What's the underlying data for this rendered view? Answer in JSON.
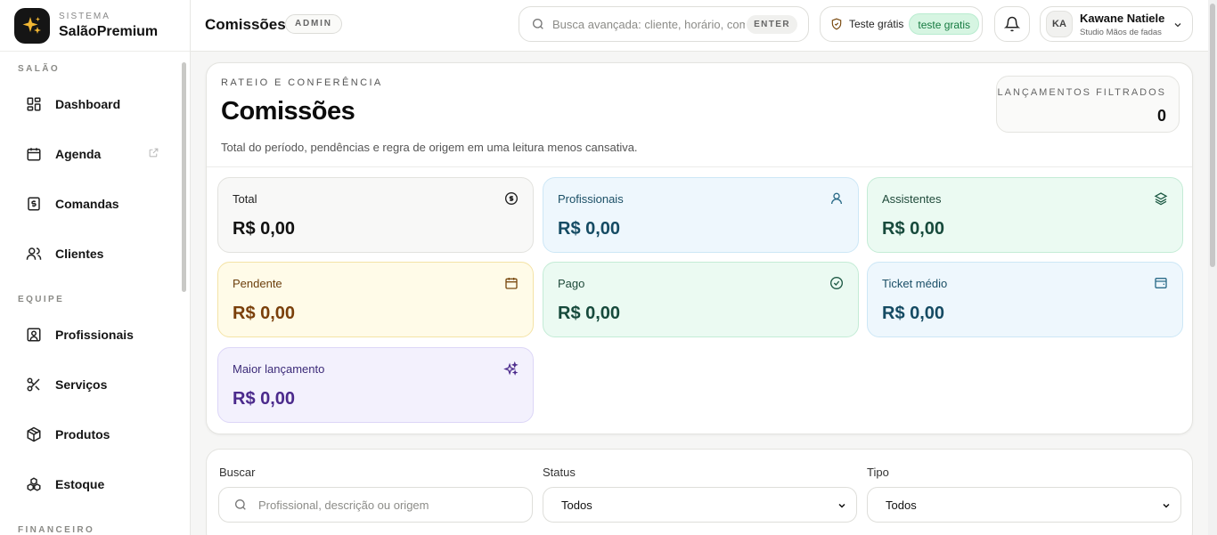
{
  "brand": {
    "system_label": "SISTEMA",
    "name": "SalãoPremium",
    "logo_icon": "sparkles-icon"
  },
  "sidebar": {
    "sections": [
      {
        "title": "SALÃO",
        "items": [
          {
            "label": "Dashboard",
            "icon": "grid-icon"
          },
          {
            "label": "Agenda",
            "icon": "calendar-icon",
            "external": true
          },
          {
            "label": "Comandas",
            "icon": "receipt-icon"
          },
          {
            "label": "Clientes",
            "icon": "users-icon"
          }
        ]
      },
      {
        "title": "EQUIPE",
        "items": [
          {
            "label": "Profissionais",
            "icon": "id-badge-icon"
          },
          {
            "label": "Serviços",
            "icon": "scissors-icon"
          },
          {
            "label": "Produtos",
            "icon": "box-icon"
          },
          {
            "label": "Estoque",
            "icon": "boxes-icon"
          }
        ]
      },
      {
        "title": "FINANCEIRO"
      }
    ]
  },
  "header": {
    "title": "Comissões",
    "role": "ADMIN",
    "search_placeholder": "Busca avançada: cliente, horário, comanda",
    "search_key": "ENTER",
    "trial_label": "Teste grátis",
    "trial_status": "teste gratis",
    "user": {
      "initials": "KA",
      "name": "Kawane Natiele",
      "studio": "Studio Mãos de fadas"
    }
  },
  "summary": {
    "eyebrow": "RATEIO E CONFERÊNCIA",
    "title": "Comissões",
    "description": "Total do período, pendências e regra de origem em uma leitura menos cansativa.",
    "counter_label": "LANÇAMENTOS FILTRADOS",
    "counter_value": "0",
    "stats": [
      {
        "label": "Total",
        "value": "R$ 0,00",
        "icon": "dollar-circle-icon",
        "bg": "#f8f8f7",
        "border": "#e2e2de",
        "label_color": "#222222",
        "value_color": "#111111",
        "icon_color": "#222222"
      },
      {
        "label": "Profissionais",
        "value": "R$ 0,00",
        "icon": "user-icon",
        "bg": "#eef7fd",
        "border": "#cde7f6",
        "label_color": "#1b4f66",
        "value_color": "#154b63",
        "icon_color": "#2a6b88"
      },
      {
        "label": "Assistentes",
        "value": "R$ 0,00",
        "icon": "layers-icon",
        "bg": "#ebfaf2",
        "border": "#c4ecd6",
        "label_color": "#1f4a3a",
        "value_color": "#174a3c",
        "icon_color": "#1e5a45"
      },
      {
        "label": "Pendente",
        "value": "R$ 0,00",
        "icon": "calendar-icon",
        "bg": "#fffbe8",
        "border": "#f4e3a6",
        "label_color": "#6b3e0c",
        "value_color": "#7a3f0a",
        "icon_color": "#7a4a10"
      },
      {
        "label": "Pago",
        "value": "R$ 0,00",
        "icon": "check-circle-icon",
        "bg": "#ebfaf2",
        "border": "#c4ecd6",
        "label_color": "#1f4a3a",
        "value_color": "#174a3c",
        "icon_color": "#1e5a45"
      },
      {
        "label": "Ticket médio",
        "value": "R$ 0,00",
        "icon": "wallet-icon",
        "bg": "#eef7fd",
        "border": "#cde7f6",
        "label_color": "#1b4f66",
        "value_color": "#154b63",
        "icon_color": "#2a6b88"
      },
      {
        "label": "Maior lançamento",
        "value": "R$ 0,00",
        "icon": "sparkles-icon",
        "bg": "#f3f1fd",
        "border": "#dcd6f7",
        "label_color": "#3b2a78",
        "value_color": "#4b2a8c",
        "icon_color": "#4b2a8c"
      }
    ]
  },
  "filters": {
    "search_label": "Buscar",
    "search_placeholder": "Profissional, descrição ou origem",
    "status_label": "Status",
    "status_value": "Todos",
    "type_label": "Tipo",
    "type_value": "Todos"
  }
}
